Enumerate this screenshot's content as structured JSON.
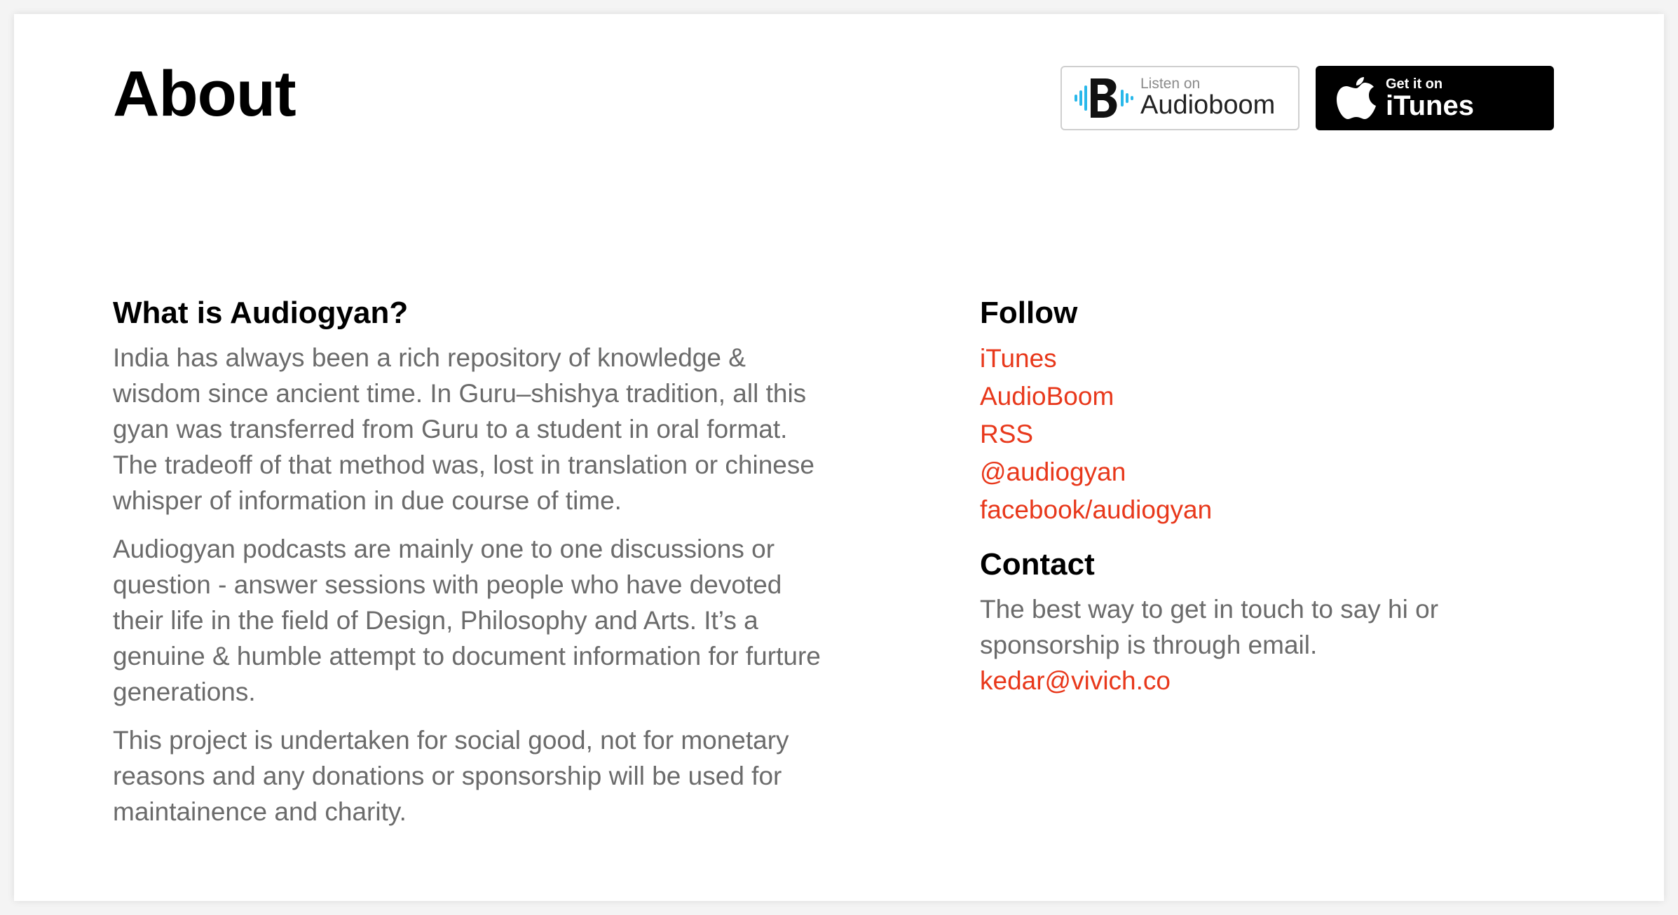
{
  "page": {
    "title": "About"
  },
  "badges": {
    "audioboom": {
      "small": "Listen on",
      "big": "Audioboom",
      "accent": "#29b8ea"
    },
    "itunes": {
      "small": "Get it on",
      "big": "iTunes"
    }
  },
  "about": {
    "heading": "What is Audiogyan?",
    "paragraphs": [
      "India has always been a rich repository of knowledge & wisdom since ancient time. In Guru–shishya tradition, all this gyan was transferred from Guru to a student in oral format. The tradeoff of that method was, lost in translation or chinese whisper of information in due course of time.",
      "Audiogyan podcasts are mainly one to one discussions or question - answer sessions with people who have devoted their life in the field of Design, Philosophy and Arts. It’s a genuine & humble attempt to document information for furture generations.",
      "This project is undertaken for social good, not for monetary reasons and any donations or sponsorship will be used for maintainence and charity."
    ]
  },
  "follow": {
    "heading": "Follow",
    "links": [
      "iTunes",
      "AudioBoom",
      "RSS",
      "@audiogyan",
      "facebook/audiogyan"
    ]
  },
  "contact": {
    "heading": "Contact",
    "text": "The best way to get in touch to say hi or sponsorship is through email.",
    "email": "kedar@vivich.co"
  },
  "colors": {
    "link": "#e8381b",
    "body_text": "#6b6b6b",
    "heading": "#000000"
  }
}
